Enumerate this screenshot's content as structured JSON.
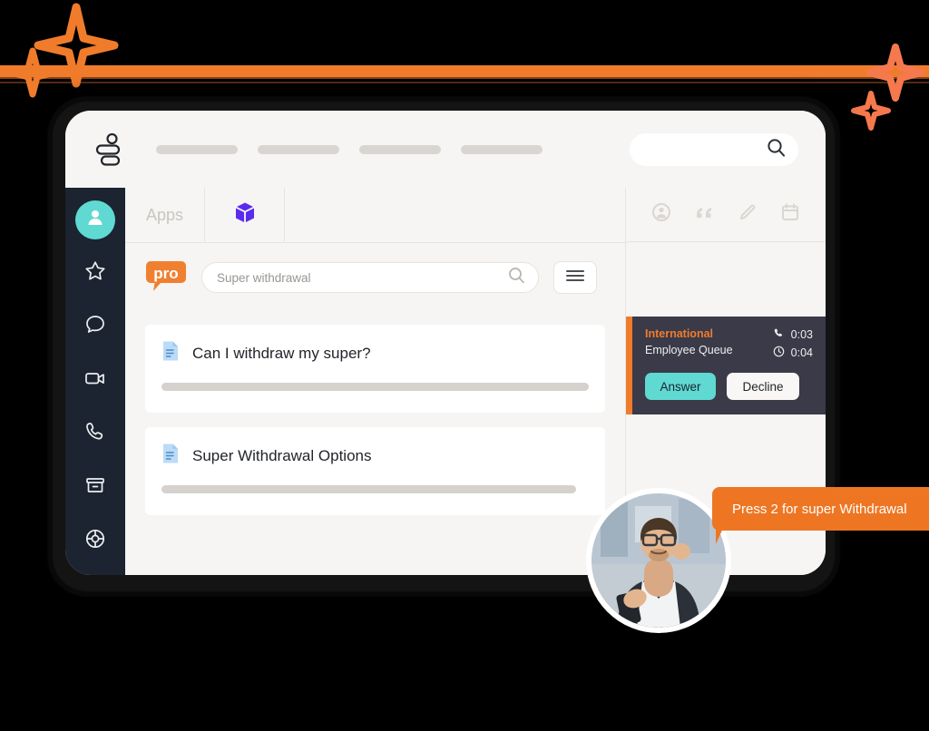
{
  "colors": {
    "accent_orange": "#F07C2B",
    "callout_orange": "#EE7623",
    "teal": "#5FD9D2",
    "rail_dark": "#1B2430",
    "call_panel": "#3A3A49",
    "page_bg": "#F6F5F3",
    "cube_purple": "#5B2BEE"
  },
  "topbar": {
    "logo_name": "app-logo",
    "nav_placeholder_widths": [
      88,
      88,
      88,
      88
    ],
    "search": {
      "placeholder": "",
      "value": "",
      "icon": "search-icon"
    }
  },
  "rail": {
    "items": [
      {
        "icon": "user-avatar-icon",
        "label": "Contacts",
        "active": true
      },
      {
        "icon": "star-icon",
        "label": "Favourites",
        "active": false
      },
      {
        "icon": "chat-bubble-icon",
        "label": "Messages",
        "active": false
      },
      {
        "icon": "video-camera-icon",
        "label": "Video",
        "active": false
      },
      {
        "icon": "phone-icon",
        "label": "Calls",
        "active": false
      },
      {
        "icon": "archive-box-icon",
        "label": "Archive",
        "active": false
      },
      {
        "icon": "target-icon",
        "label": "Settings",
        "active": false
      }
    ]
  },
  "tabs": [
    {
      "label": "Apps",
      "icon": null
    },
    {
      "label": "",
      "icon": "cube-icon"
    }
  ],
  "toolbar": {
    "logo_text": "pro",
    "search": {
      "value": "",
      "placeholder": "Super withdrawal",
      "icon": "search-icon"
    },
    "menu_button": {
      "icon": "hamburger-menu-icon",
      "label": ""
    }
  },
  "results": [
    {
      "icon": "document-icon",
      "title": "Can I withdraw my super?",
      "line_width": "100%"
    },
    {
      "icon": "document-icon",
      "title": "Super Withdrawal Options",
      "line_width": "97%"
    }
  ],
  "right_panel": {
    "tools": [
      {
        "icon": "person-circle-icon",
        "label": "Profile"
      },
      {
        "icon": "quote-icon",
        "label": "Notes"
      },
      {
        "icon": "pencil-icon",
        "label": "Edit"
      },
      {
        "icon": "calendar-icon",
        "label": "Calendar"
      }
    ],
    "incoming_call": {
      "queue_name": "International",
      "queue_sub": "Employee Queue",
      "call_timer": "0:03",
      "wait_timer": "0:04",
      "call_timer_icon": "phone-icon",
      "wait_timer_icon": "clock-icon",
      "answer_label": "Answer",
      "decline_label": "Decline"
    }
  },
  "callout": {
    "text": "Press 2 for super Withdrawal"
  },
  "person": {
    "alt": "Smiling man with glasses holding a phone"
  }
}
